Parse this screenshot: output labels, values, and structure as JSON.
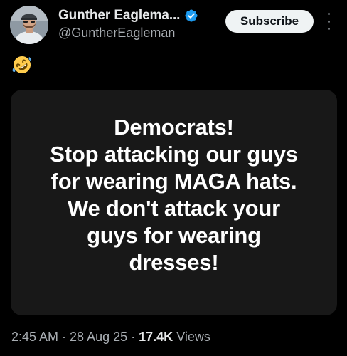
{
  "post": {
    "author": {
      "display_name": "Gunther Eaglema...",
      "handle": "@GuntherEagleman",
      "verified_icon": "verified-badge-icon",
      "avatar_icon": "avatar-photo"
    },
    "subscribe_label": "Subscribe",
    "more_icon": "more-vertical-icon",
    "text_emoji": "rolling-on-floor-laughing-emoji",
    "media_text": [
      "Democrats!",
      "Stop attacking our guys",
      "for wearing MAGA hats.",
      "We don't attack your",
      "guys for wearing",
      "dresses!"
    ],
    "time": "2:45 AM",
    "date": "28 Aug 25",
    "separator": "·",
    "views_count": "17.4K",
    "views_label": "Views"
  },
  "colors": {
    "background": "#000000",
    "primary_text": "#e7e9ea",
    "secondary_text": "#a8adb2",
    "verified_blue": "#1d9bf0",
    "card_background": "#181818",
    "button_background": "#eff3f4"
  }
}
